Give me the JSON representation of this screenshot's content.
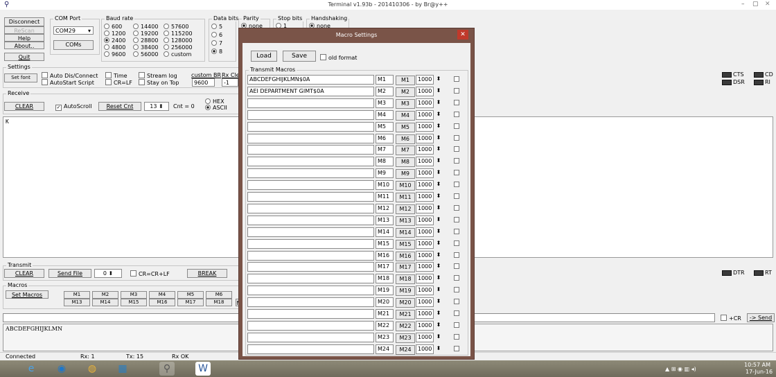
{
  "window": {
    "title": "Terminal v1.93b - 201410306 - by Br@y++",
    "min": "–",
    "max": "▢",
    "close": "✕"
  },
  "connection": {
    "disconnect": "Disconnect",
    "rescan": "ReScan",
    "help": "Help",
    "about": "About..",
    "quit": "Quit"
  },
  "com_port": {
    "legend": "COM Port",
    "value": "COM29",
    "coms": "COMs"
  },
  "baud": {
    "legend": "Baud rate",
    "options": [
      "600",
      "1200",
      "2400",
      "4800",
      "9600",
      "14400",
      "19200",
      "28800",
      "38400",
      "56000",
      "57600",
      "115200",
      "128000",
      "256000",
      "custom"
    ],
    "selected": "2400"
  },
  "data_bits": {
    "legend": "Data bits",
    "options": [
      "5",
      "6",
      "7",
      "8"
    ],
    "selected": "8"
  },
  "parity": {
    "legend": "Parity",
    "selected": "none"
  },
  "stop_bits": {
    "legend": "Stop bits",
    "selected": "1"
  },
  "handshaking": {
    "legend": "Handshaking",
    "selected": "none"
  },
  "settings": {
    "legend": "Settings",
    "set_font": "Set font",
    "auto_dis": "Auto Dis/Connect",
    "autostart": "AutoStart Script",
    "time": "Time",
    "crlf": "CR=LF",
    "stream_log": "Stream log",
    "stay_on_top": "Stay on Top",
    "custom_br_label": "custom BR",
    "custom_br_value": "9600",
    "rx_clear_label": "Rx Cle",
    "rx_clear_value": "-1"
  },
  "receive": {
    "legend": "Receive",
    "clear": "CLEAR",
    "autoscroll": "AutoScroll",
    "reset_cnt": "Reset Cnt",
    "cnt_spin": "13",
    "cnt_label": "Cnt = 0",
    "hex": "HEX",
    "ascii": "ASCII",
    "content": "K"
  },
  "signals": {
    "cts": "CTS",
    "cd": "CD",
    "dsr": "DSR",
    "ri": "RI",
    "dtr": "DTR",
    "rts": "RT"
  },
  "transmit": {
    "legend": "Transmit",
    "clear": "CLEAR",
    "send_file": "Send File",
    "spin_value": "0",
    "crcrlf": "CR=CR+LF",
    "break": "BREAK"
  },
  "macros": {
    "legend": "Macros",
    "set_macros": "Set Macros",
    "row1": [
      "M1",
      "M2",
      "M3",
      "M4",
      "M5",
      "M6"
    ],
    "row2": [
      "M13",
      "M14",
      "M15",
      "M16",
      "M17",
      "M18"
    ],
    "trailing": "M"
  },
  "send_bar": {
    "cr_label": "+CR",
    "send": "-> Send"
  },
  "transmit_log": "ABCDEFGHIJKLMN",
  "status": {
    "state": "Connected",
    "rx": "Rx: 1",
    "tx": "Tx: 15",
    "rxok": "Rx OK"
  },
  "dialog": {
    "title": "Macro Settings",
    "load": "Load",
    "save": "Save",
    "old_format": "old format",
    "legend": "Transmit Macros",
    "macros": [
      {
        "text": "ABCDEFGHIJKLMN$0A",
        "name": "M1",
        "button": "M1",
        "delay": "1000"
      },
      {
        "text": "AEI DEPARTMENT GIMT$0A",
        "name": "M2",
        "button": "M2",
        "delay": "1000"
      },
      {
        "text": "",
        "name": "M3",
        "button": "M3",
        "delay": "1000"
      },
      {
        "text": "",
        "name": "M4",
        "button": "M4",
        "delay": "1000"
      },
      {
        "text": "",
        "name": "M5",
        "button": "M5",
        "delay": "1000"
      },
      {
        "text": "",
        "name": "M6",
        "button": "M6",
        "delay": "1000"
      },
      {
        "text": "",
        "name": "M7",
        "button": "M7",
        "delay": "1000"
      },
      {
        "text": "",
        "name": "M8",
        "button": "M8",
        "delay": "1000"
      },
      {
        "text": "",
        "name": "M9",
        "button": "M9",
        "delay": "1000"
      },
      {
        "text": "",
        "name": "M10",
        "button": "M10",
        "delay": "1000"
      },
      {
        "text": "",
        "name": "M11",
        "button": "M11",
        "delay": "1000"
      },
      {
        "text": "",
        "name": "M12",
        "button": "M12",
        "delay": "1000"
      },
      {
        "text": "",
        "name": "M13",
        "button": "M13",
        "delay": "1000"
      },
      {
        "text": "",
        "name": "M14",
        "button": "M14",
        "delay": "1000"
      },
      {
        "text": "",
        "name": "M15",
        "button": "M15",
        "delay": "1000"
      },
      {
        "text": "",
        "name": "M16",
        "button": "M16",
        "delay": "1000"
      },
      {
        "text": "",
        "name": "M17",
        "button": "M17",
        "delay": "1000"
      },
      {
        "text": "",
        "name": "M18",
        "button": "M18",
        "delay": "1000"
      },
      {
        "text": "",
        "name": "M19",
        "button": "M19",
        "delay": "1000"
      },
      {
        "text": "",
        "name": "M20",
        "button": "M20",
        "delay": "1000"
      },
      {
        "text": "",
        "name": "M21",
        "button": "M21",
        "delay": "1000"
      },
      {
        "text": "",
        "name": "M22",
        "button": "M22",
        "delay": "1000"
      },
      {
        "text": "",
        "name": "M23",
        "button": "M23",
        "delay": "1000"
      },
      {
        "text": "",
        "name": "M24",
        "button": "M24",
        "delay": "1000"
      }
    ]
  },
  "taskbar": {
    "time": "10:57 AM",
    "date": "17-Jun-16",
    "tray": "▲ ⊞ ◉ ▥ ◂)"
  },
  "colors": {
    "dialog_frame": "#7a5448",
    "close_button": "#c0392b",
    "led": "#3a3a3a"
  }
}
